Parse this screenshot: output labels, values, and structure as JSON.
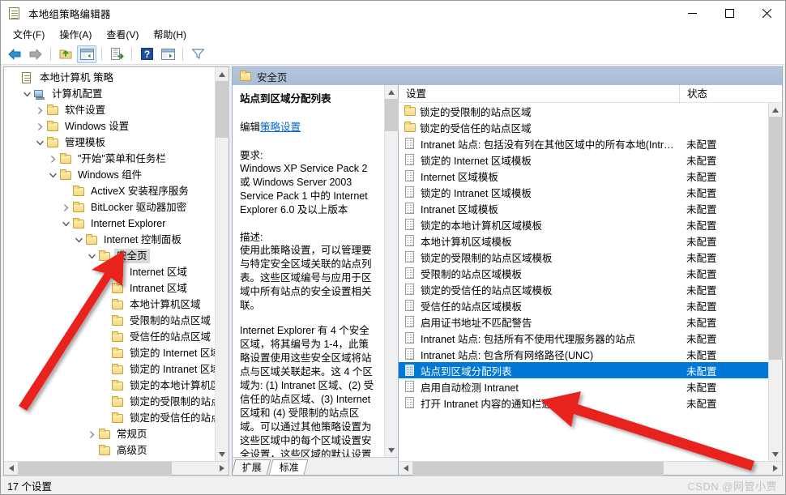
{
  "window": {
    "title": "本地组策略编辑器",
    "app_icon": "document-policy-icon",
    "minimize_label": "最小化",
    "maximize_label": "最大化",
    "close_label": "关闭"
  },
  "menubar": {
    "items": [
      {
        "label": "文件(F)",
        "name": "menu-file"
      },
      {
        "label": "操作(A)",
        "name": "menu-action"
      },
      {
        "label": "查看(V)",
        "name": "menu-view"
      },
      {
        "label": "帮助(H)",
        "name": "menu-help"
      }
    ]
  },
  "toolbar": {
    "buttons": [
      {
        "name": "back-button",
        "icon": "arrow-left-icon",
        "label": "后退"
      },
      {
        "name": "forward-button",
        "icon": "arrow-right-icon",
        "label": "前进"
      },
      {
        "name": "up-folder-button",
        "icon": "folder-up-icon",
        "label": "上一层"
      },
      {
        "name": "show-hide-tree-button",
        "icon": "show-tree-icon",
        "label": "显示/隐藏控制台树",
        "pressed": true
      },
      {
        "name": "export-list-button",
        "icon": "export-list-icon",
        "label": "导出列表"
      },
      {
        "name": "help-button",
        "icon": "help-question-icon",
        "label": "帮助"
      },
      {
        "name": "properties-button",
        "icon": "properties-window-icon",
        "label": "属性"
      },
      {
        "name": "filter-button",
        "icon": "filter-funnel-icon",
        "label": "筛选器"
      }
    ]
  },
  "tree": {
    "nodes": [
      {
        "label": "本地计算机 策略",
        "indent": 0,
        "twisty": "none",
        "icon": "policy-document-icon",
        "selected": false
      },
      {
        "label": "计算机配置",
        "indent": 1,
        "twisty": "expanded",
        "icon": "computer-icon",
        "selected": false
      },
      {
        "label": "软件设置",
        "indent": 2,
        "twisty": "collapsed",
        "icon": "folder-icon",
        "selected": false
      },
      {
        "label": "Windows 设置",
        "indent": 2,
        "twisty": "collapsed",
        "icon": "folder-icon",
        "selected": false
      },
      {
        "label": "管理模板",
        "indent": 2,
        "twisty": "expanded",
        "icon": "folder-icon",
        "selected": false
      },
      {
        "label": "\"开始\"菜单和任务栏",
        "indent": 3,
        "twisty": "collapsed",
        "icon": "folder-icon",
        "selected": false
      },
      {
        "label": "Windows 组件",
        "indent": 3,
        "twisty": "expanded",
        "icon": "folder-icon",
        "selected": false
      },
      {
        "label": "ActiveX 安装程序服务",
        "indent": 4,
        "twisty": "none",
        "icon": "folder-icon",
        "selected": false
      },
      {
        "label": "BitLocker 驱动器加密",
        "indent": 4,
        "twisty": "collapsed",
        "icon": "folder-icon",
        "selected": false
      },
      {
        "label": "Internet Explorer",
        "indent": 4,
        "twisty": "expanded",
        "icon": "folder-icon",
        "selected": false
      },
      {
        "label": "Internet 控制面板",
        "indent": 5,
        "twisty": "expanded",
        "icon": "folder-icon",
        "selected": false
      },
      {
        "label": "安全页",
        "indent": 6,
        "twisty": "expanded",
        "icon": "folder-icon",
        "selected": true
      },
      {
        "label": "Internet 区域",
        "indent": 7,
        "twisty": "none",
        "icon": "folder-icon",
        "selected": false
      },
      {
        "label": "Intranet 区域",
        "indent": 7,
        "twisty": "none",
        "icon": "folder-icon",
        "selected": false
      },
      {
        "label": "本地计算机区域",
        "indent": 7,
        "twisty": "none",
        "icon": "folder-icon",
        "selected": false
      },
      {
        "label": "受限制的站点区域",
        "indent": 7,
        "twisty": "none",
        "icon": "folder-icon",
        "selected": false
      },
      {
        "label": "受信任的站点区域",
        "indent": 7,
        "twisty": "none",
        "icon": "folder-icon",
        "selected": false
      },
      {
        "label": "锁定的 Internet 区域",
        "indent": 7,
        "twisty": "none",
        "icon": "folder-icon",
        "selected": false
      },
      {
        "label": "锁定的 Intranet 区域",
        "indent": 7,
        "twisty": "none",
        "icon": "folder-icon",
        "selected": false
      },
      {
        "label": "锁定的本地计算机区域",
        "indent": 7,
        "twisty": "none",
        "icon": "folder-icon",
        "selected": false
      },
      {
        "label": "锁定的受限制的站点区域",
        "indent": 7,
        "twisty": "none",
        "icon": "folder-icon",
        "selected": false
      },
      {
        "label": "锁定的受信任的站点区域",
        "indent": 7,
        "twisty": "none",
        "icon": "folder-icon",
        "selected": false
      },
      {
        "label": "常规页",
        "indent": 6,
        "twisty": "collapsed",
        "icon": "folder-icon",
        "selected": false
      },
      {
        "label": "高级页",
        "indent": 6,
        "twisty": "none",
        "icon": "folder-icon",
        "selected": false
      }
    ]
  },
  "pane_header": {
    "icon": "folder-icon",
    "title": "安全页"
  },
  "detail": {
    "title": "站点到区域分配列表",
    "edit_prefix": "编辑",
    "edit_link": "策略设置",
    "requirement_label": "要求:",
    "requirement_text": "Windows XP Service Pack 2 或 Windows Server 2003 Service Pack 1 中的 Internet Explorer 6.0 及以上版本",
    "description_label": "描述:",
    "description_p1": "使用此策略设置，可以管理要与特定安全区域关联的站点列表。这些区域编号与应用于区域中所有站点的安全设置相关联。",
    "description_p2": "Internet Explorer 有 4 个安全区域，将其编号为 1-4，此策略设置使用这些安全区域将站点与区域关联起来。这 4 个区域为: (1) Intranet 区域、(2) 受信任的站点区域、(3) Internet 区域和 (4) 受限制的站点区域。可以通过其他策略设置为这些区域中的每个区域设置安全设置，这些区域的默认设置如下: 受信任的站点区域(低模板)、",
    "tabs": [
      {
        "label": "扩展",
        "name": "tab-extended",
        "active": false
      },
      {
        "label": "标准",
        "name": "tab-standard",
        "active": true
      }
    ]
  },
  "list": {
    "columns": [
      {
        "label": "设置",
        "name": "column-setting"
      },
      {
        "label": "状态",
        "name": "column-state"
      }
    ],
    "rows": [
      {
        "name": "锁定的受限制的站点区域",
        "state": "",
        "icon": "folder-icon",
        "selected": false
      },
      {
        "name": "锁定的受信任的站点区域",
        "state": "",
        "icon": "folder-icon",
        "selected": false
      },
      {
        "name": "Intranet 站点: 包括没有列在其他区域中的所有本地(Intrane...",
        "state": "未配置",
        "icon": "setting-icon",
        "selected": false
      },
      {
        "name": "锁定的 Internet 区域模板",
        "state": "未配置",
        "icon": "setting-icon",
        "selected": false
      },
      {
        "name": "Internet 区域模板",
        "state": "未配置",
        "icon": "setting-icon",
        "selected": false
      },
      {
        "name": "锁定的 Intranet 区域模板",
        "state": "未配置",
        "icon": "setting-icon",
        "selected": false
      },
      {
        "name": "Intranet 区域模板",
        "state": "未配置",
        "icon": "setting-icon",
        "selected": false
      },
      {
        "name": "锁定的本地计算机区域模板",
        "state": "未配置",
        "icon": "setting-icon",
        "selected": false
      },
      {
        "name": "本地计算机区域模板",
        "state": "未配置",
        "icon": "setting-icon",
        "selected": false
      },
      {
        "name": "锁定的受限制的站点区域模板",
        "state": "未配置",
        "icon": "setting-icon",
        "selected": false
      },
      {
        "name": "受限制的站点区域模板",
        "state": "未配置",
        "icon": "setting-icon",
        "selected": false
      },
      {
        "name": "锁定的受信任的站点区域模板",
        "state": "未配置",
        "icon": "setting-icon",
        "selected": false
      },
      {
        "name": "受信任的站点区域模板",
        "state": "未配置",
        "icon": "setting-icon",
        "selected": false
      },
      {
        "name": "启用证书地址不匹配警告",
        "state": "未配置",
        "icon": "setting-icon",
        "selected": false
      },
      {
        "name": "Intranet 站点: 包括所有不使用代理服务器的站点",
        "state": "未配置",
        "icon": "setting-icon",
        "selected": false
      },
      {
        "name": "Intranet 站点: 包含所有网络路径(UNC)",
        "state": "未配置",
        "icon": "setting-icon",
        "selected": false
      },
      {
        "name": "站点到区域分配列表",
        "state": "未配置",
        "icon": "setting-icon",
        "selected": true
      },
      {
        "name": "启用自动检测 Intranet",
        "state": "未配置",
        "icon": "setting-icon",
        "selected": false
      },
      {
        "name": "打开 Intranet 内容的通知栏通知",
        "state": "未配置",
        "icon": "setting-icon",
        "selected": false
      }
    ]
  },
  "statusbar": {
    "text": "17 个设置",
    "watermark": "CSDN @网管小贾"
  },
  "colors": {
    "selection_blue": "#0078d7",
    "pane_header": "#a8bcd6",
    "annotation_red": "#e8231f",
    "link_blue": "#0066cc"
  }
}
